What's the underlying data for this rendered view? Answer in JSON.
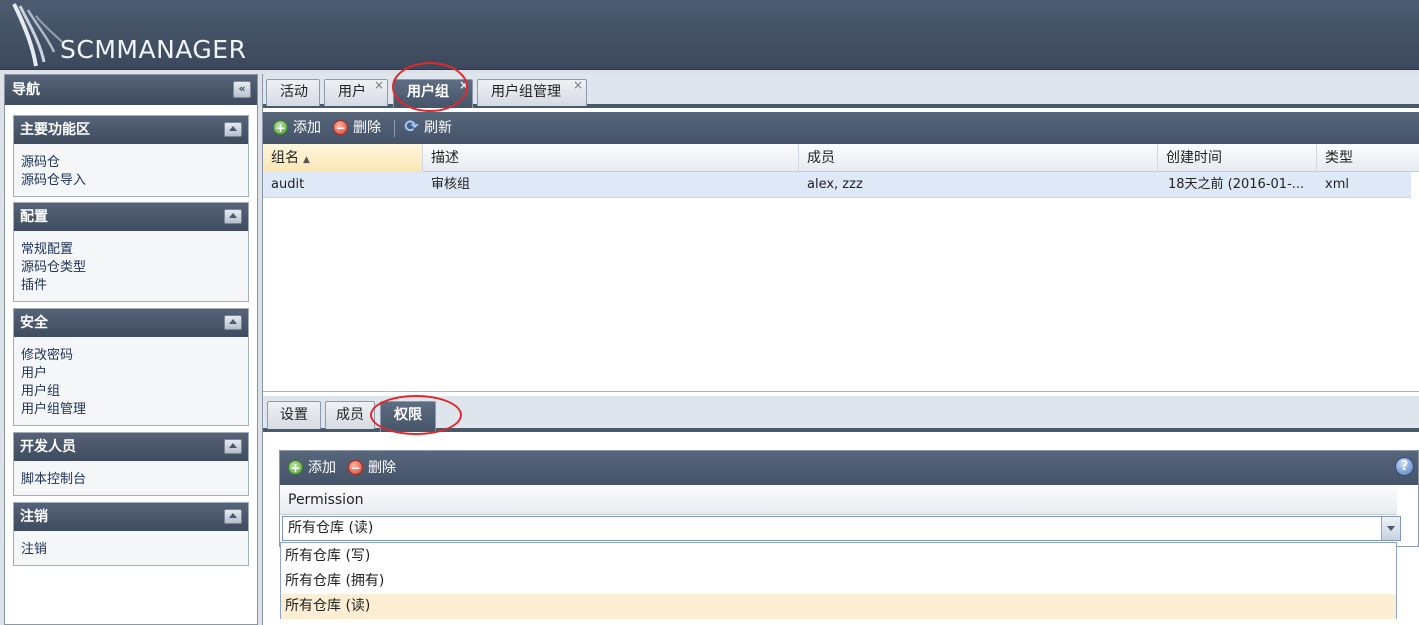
{
  "app": {
    "logo_text": "SCMMANAGER"
  },
  "nav": {
    "title": "导航",
    "panels": [
      {
        "title": "主要功能区",
        "items": [
          "源码仓",
          "源码仓导入"
        ]
      },
      {
        "title": "配置",
        "items": [
          "常规配置",
          "源码仓类型",
          "插件"
        ]
      },
      {
        "title": "安全",
        "items": [
          "修改密码",
          "用户",
          "用户组",
          "用户组管理"
        ]
      },
      {
        "title": "开发人员",
        "items": [
          "脚本控制台"
        ]
      },
      {
        "title": "注销",
        "items": [
          "注销"
        ]
      }
    ]
  },
  "tabs": [
    {
      "label": "活动",
      "closable": false,
      "active": false
    },
    {
      "label": "用户",
      "closable": true,
      "active": false
    },
    {
      "label": "用户组",
      "closable": true,
      "active": true
    },
    {
      "label": "用户组管理",
      "closable": true,
      "active": false
    }
  ],
  "toolbar": {
    "add": "添加",
    "delete": "删除",
    "refresh": "刷新"
  },
  "grid": {
    "columns": [
      "组名",
      "描述",
      "成员",
      "创建时间",
      "类型"
    ],
    "sort_column": "组名",
    "rows": [
      {
        "name": "audit",
        "description": "审核组",
        "members": "alex, zzz",
        "created": "18天之前 (2016-01-...",
        "type": "xml"
      }
    ]
  },
  "subtabs": [
    {
      "label": "设置",
      "active": false
    },
    {
      "label": "成员",
      "active": false
    },
    {
      "label": "权限",
      "active": true
    }
  ],
  "permissions": {
    "add": "添加",
    "delete": "删除",
    "help": "?",
    "column": "Permission",
    "combo_value": "所有仓库 (读)",
    "options": [
      "所有仓库 (写)",
      "所有仓库 (拥有)",
      "所有仓库 (读)"
    ],
    "selected_index": 2
  },
  "colors": {
    "annotation": "#e0282c",
    "header": "#4a586c",
    "selection": "#fbeed3"
  }
}
